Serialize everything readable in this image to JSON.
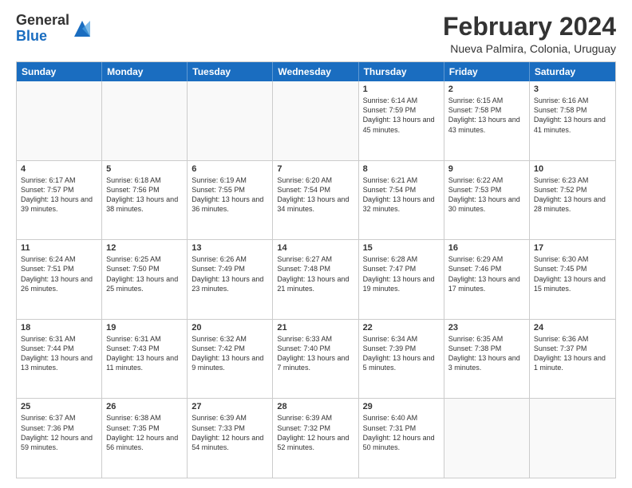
{
  "header": {
    "logo_general": "General",
    "logo_blue": "Blue",
    "month_title": "February 2024",
    "location": "Nueva Palmira, Colonia, Uruguay"
  },
  "weekdays": [
    "Sunday",
    "Monday",
    "Tuesday",
    "Wednesday",
    "Thursday",
    "Friday",
    "Saturday"
  ],
  "rows": [
    [
      {
        "day": "",
        "text": ""
      },
      {
        "day": "",
        "text": ""
      },
      {
        "day": "",
        "text": ""
      },
      {
        "day": "",
        "text": ""
      },
      {
        "day": "1",
        "text": "Sunrise: 6:14 AM\nSunset: 7:59 PM\nDaylight: 13 hours\nand 45 minutes."
      },
      {
        "day": "2",
        "text": "Sunrise: 6:15 AM\nSunset: 7:58 PM\nDaylight: 13 hours\nand 43 minutes."
      },
      {
        "day": "3",
        "text": "Sunrise: 6:16 AM\nSunset: 7:58 PM\nDaylight: 13 hours\nand 41 minutes."
      }
    ],
    [
      {
        "day": "4",
        "text": "Sunrise: 6:17 AM\nSunset: 7:57 PM\nDaylight: 13 hours\nand 39 minutes."
      },
      {
        "day": "5",
        "text": "Sunrise: 6:18 AM\nSunset: 7:56 PM\nDaylight: 13 hours\nand 38 minutes."
      },
      {
        "day": "6",
        "text": "Sunrise: 6:19 AM\nSunset: 7:55 PM\nDaylight: 13 hours\nand 36 minutes."
      },
      {
        "day": "7",
        "text": "Sunrise: 6:20 AM\nSunset: 7:54 PM\nDaylight: 13 hours\nand 34 minutes."
      },
      {
        "day": "8",
        "text": "Sunrise: 6:21 AM\nSunset: 7:54 PM\nDaylight: 13 hours\nand 32 minutes."
      },
      {
        "day": "9",
        "text": "Sunrise: 6:22 AM\nSunset: 7:53 PM\nDaylight: 13 hours\nand 30 minutes."
      },
      {
        "day": "10",
        "text": "Sunrise: 6:23 AM\nSunset: 7:52 PM\nDaylight: 13 hours\nand 28 minutes."
      }
    ],
    [
      {
        "day": "11",
        "text": "Sunrise: 6:24 AM\nSunset: 7:51 PM\nDaylight: 13 hours\nand 26 minutes."
      },
      {
        "day": "12",
        "text": "Sunrise: 6:25 AM\nSunset: 7:50 PM\nDaylight: 13 hours\nand 25 minutes."
      },
      {
        "day": "13",
        "text": "Sunrise: 6:26 AM\nSunset: 7:49 PM\nDaylight: 13 hours\nand 23 minutes."
      },
      {
        "day": "14",
        "text": "Sunrise: 6:27 AM\nSunset: 7:48 PM\nDaylight: 13 hours\nand 21 minutes."
      },
      {
        "day": "15",
        "text": "Sunrise: 6:28 AM\nSunset: 7:47 PM\nDaylight: 13 hours\nand 19 minutes."
      },
      {
        "day": "16",
        "text": "Sunrise: 6:29 AM\nSunset: 7:46 PM\nDaylight: 13 hours\nand 17 minutes."
      },
      {
        "day": "17",
        "text": "Sunrise: 6:30 AM\nSunset: 7:45 PM\nDaylight: 13 hours\nand 15 minutes."
      }
    ],
    [
      {
        "day": "18",
        "text": "Sunrise: 6:31 AM\nSunset: 7:44 PM\nDaylight: 13 hours\nand 13 minutes."
      },
      {
        "day": "19",
        "text": "Sunrise: 6:31 AM\nSunset: 7:43 PM\nDaylight: 13 hours\nand 11 minutes."
      },
      {
        "day": "20",
        "text": "Sunrise: 6:32 AM\nSunset: 7:42 PM\nDaylight: 13 hours\nand 9 minutes."
      },
      {
        "day": "21",
        "text": "Sunrise: 6:33 AM\nSunset: 7:40 PM\nDaylight: 13 hours\nand 7 minutes."
      },
      {
        "day": "22",
        "text": "Sunrise: 6:34 AM\nSunset: 7:39 PM\nDaylight: 13 hours\nand 5 minutes."
      },
      {
        "day": "23",
        "text": "Sunrise: 6:35 AM\nSunset: 7:38 PM\nDaylight: 13 hours\nand 3 minutes."
      },
      {
        "day": "24",
        "text": "Sunrise: 6:36 AM\nSunset: 7:37 PM\nDaylight: 13 hours\nand 1 minute."
      }
    ],
    [
      {
        "day": "25",
        "text": "Sunrise: 6:37 AM\nSunset: 7:36 PM\nDaylight: 12 hours\nand 59 minutes."
      },
      {
        "day": "26",
        "text": "Sunrise: 6:38 AM\nSunset: 7:35 PM\nDaylight: 12 hours\nand 56 minutes."
      },
      {
        "day": "27",
        "text": "Sunrise: 6:39 AM\nSunset: 7:33 PM\nDaylight: 12 hours\nand 54 minutes."
      },
      {
        "day": "28",
        "text": "Sunrise: 6:39 AM\nSunset: 7:32 PM\nDaylight: 12 hours\nand 52 minutes."
      },
      {
        "day": "29",
        "text": "Sunrise: 6:40 AM\nSunset: 7:31 PM\nDaylight: 12 hours\nand 50 minutes."
      },
      {
        "day": "",
        "text": ""
      },
      {
        "day": "",
        "text": ""
      }
    ]
  ]
}
